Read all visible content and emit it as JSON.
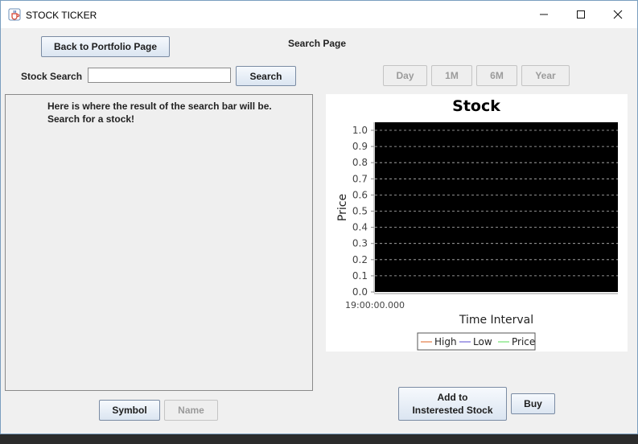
{
  "window": {
    "title": "STOCK TICKER",
    "controls": {
      "minimize": "–",
      "maximize": "☐",
      "close": "✕"
    }
  },
  "header": {
    "back_button": "Back to Portfolio Page",
    "page_title": "Search Page"
  },
  "search": {
    "label": "Stock Search",
    "value": "",
    "button": "Search"
  },
  "range_buttons": [
    "Day",
    "1M",
    "6M",
    "Year"
  ],
  "results": {
    "line1": "Here is where the result of the search bar will be.",
    "line2": "Search for a stock!"
  },
  "sort_buttons": {
    "symbol": "Symbol",
    "name": "Name"
  },
  "actions": {
    "interested_line1": "Add to",
    "interested_line2": "Insterested Stock",
    "buy": "Buy"
  },
  "chart_data": {
    "type": "line",
    "title": "Stock",
    "xlabel": "Time Interval",
    "ylabel": "Price",
    "ylim": [
      0.0,
      1.0
    ],
    "yticks": [
      "0.0",
      "0.1",
      "0.2",
      "0.3",
      "0.4",
      "0.5",
      "0.6",
      "0.7",
      "0.8",
      "0.9",
      "1.0"
    ],
    "x_tick_label": "19:00:00.000",
    "plot_background": "#000000",
    "grid": true,
    "legend_position": "bottom",
    "series": [
      {
        "name": "High",
        "color": "#e8956b",
        "values": []
      },
      {
        "name": "Low",
        "color": "#8f86e0",
        "values": []
      },
      {
        "name": "Price",
        "color": "#8fe88f",
        "values": []
      }
    ]
  }
}
